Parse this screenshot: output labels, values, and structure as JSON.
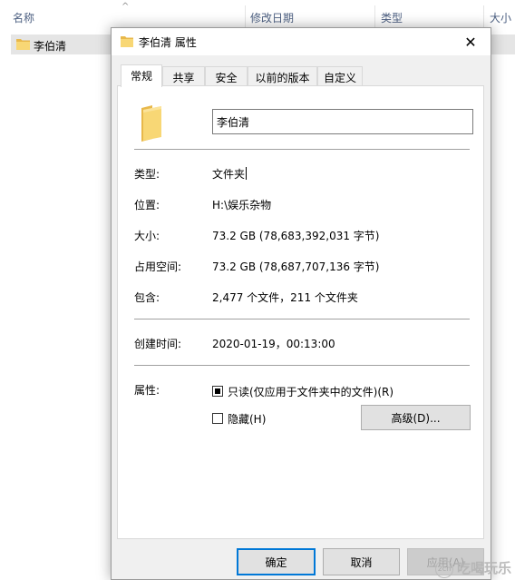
{
  "explorer": {
    "columns": {
      "name": "名称",
      "modified": "修改日期",
      "type": "类型",
      "size": "大小"
    },
    "row_name": "李伯清"
  },
  "dialog": {
    "title": "李伯清 属性",
    "close_glyph": "✕",
    "tabs": [
      "常规",
      "共享",
      "安全",
      "以前的版本",
      "自定义"
    ],
    "active_tab": "常规",
    "name_value": "李伯清",
    "props": {
      "type_label": "类型:",
      "type_value": "文件夹",
      "location_label": "位置:",
      "location_value": "H:\\娱乐杂物",
      "size_label": "大小:",
      "size_value": "73.2 GB (78,683,392,031 字节)",
      "disk_label": "占用空间:",
      "disk_value": "73.2 GB (78,687,707,136 字节)",
      "contains_label": "包含:",
      "contains_value": "2,477 个文件，211 个文件夹",
      "created_label": "创建时间:",
      "created_value": "2020-01-19，00:13:00",
      "attributes_label": "属性:"
    },
    "attributes": {
      "readonly_label": "只读(仅应用于文件夹中的文件)(R)",
      "readonly_checked": true,
      "hidden_label": "隐藏(H)",
      "hidden_checked": false,
      "advanced_label": "高级(D)..."
    },
    "buttons": {
      "ok": "确定",
      "cancel": "取消",
      "apply": "应用(A)"
    }
  },
  "watermark": {
    "badge": "2ch",
    "text": "吃喝玩乐"
  },
  "colors": {
    "folder": "#f8d775",
    "folder_dark": "#e8b84a",
    "accent": "#0078d7",
    "header_text": "#4d6082"
  },
  "icons": [
    "folder-icon",
    "close-icon",
    "sort-caret-icon"
  ]
}
